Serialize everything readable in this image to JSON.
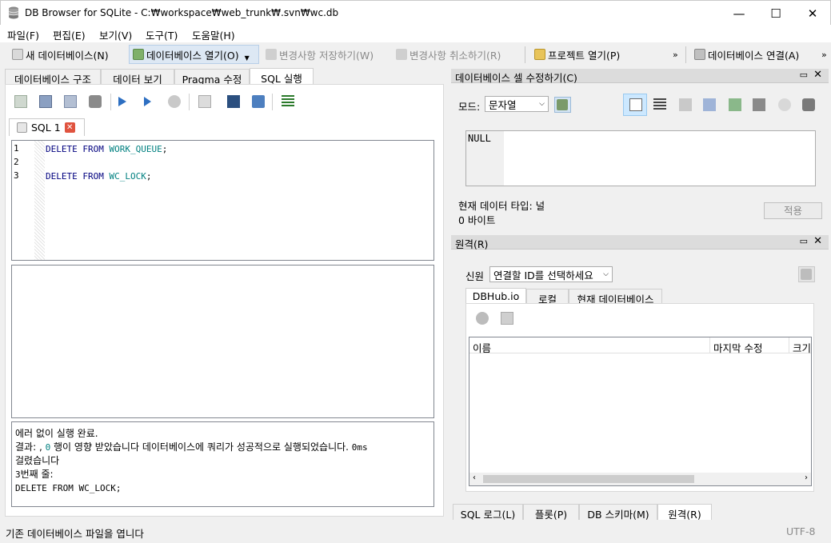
{
  "window": {
    "title": "DB Browser for SQLite - C:₩workspace₩web_trunk₩.svn₩wc.db",
    "minimize": "—",
    "maximize": "☐",
    "close": "✕"
  },
  "menu": [
    "파일(F)",
    "편집(E)",
    "보기(V)",
    "도구(T)",
    "도움말(H)"
  ],
  "toolbar": {
    "new_db": "새 데이터베이스(N)",
    "open_db": "데이터베이스 열기(O)",
    "write_changes": "변경사항 저장하기(W)",
    "revert_changes": "변경사항 취소하기(R)",
    "open_project": "프로젝트 열기(P)",
    "attach_db": "데이터베이스 연결(A)",
    "overflow": "»"
  },
  "main_tabs": [
    "데이터베이스 구조",
    "데이터 보기",
    "Pragma 수정",
    "SQL 실행"
  ],
  "sql_tab": {
    "label": "SQL 1"
  },
  "editor": {
    "line_numbers": [
      "1",
      "2",
      "3"
    ],
    "lines": [
      {
        "kw": "DELETE FROM",
        "id": "WORK_QUEUE",
        "end": ";"
      },
      {
        "kw": "",
        "id": "",
        "end": ""
      },
      {
        "kw": "DELETE FROM",
        "id": "WC_LOCK",
        "end": ";"
      }
    ]
  },
  "message": {
    "line1": "에러 없이 실행 완료.",
    "line2_a": "결과: , ",
    "line2_num": "0",
    "line2_b": " 행이 영향 받았습니다 데이터베이스에 쿼리가 성공적으로 실행되었습니다. ",
    "line2_ms": "0ms",
    "line3": "걸렸습니다",
    "line4_num": "3",
    "line4": "번째 줄:",
    "line5": "DELETE FROM WC_LOCK;"
  },
  "cell_editor": {
    "title": "데이터베이스 셀 수정하기(C)",
    "mode_label": "모드:",
    "mode_value": "문자열",
    "cell_value": "NULL",
    "type_label": "현재 데이터 타입: 널",
    "size_label": "0 바이트",
    "apply": "적용"
  },
  "remote": {
    "title": "원격(R)",
    "identity_label": "신원",
    "identity_value": "연결할 ID를 선택하세요",
    "tabs": [
      "DBHub.io",
      "로컬",
      "현재 데이터베이스"
    ],
    "columns": [
      "이름",
      "마지막 수정",
      "크기"
    ]
  },
  "bottom_tabs": [
    "SQL 로그(L)",
    "플롯(P)",
    "DB 스키마(M)",
    "원격(R)"
  ],
  "status": {
    "left": "기존 데이터베이스 파일을 엽니다",
    "right": "UTF-8"
  },
  "colors": {
    "keyword": "#00007f",
    "identifier": "#008080",
    "accent": "#cce8ff"
  }
}
